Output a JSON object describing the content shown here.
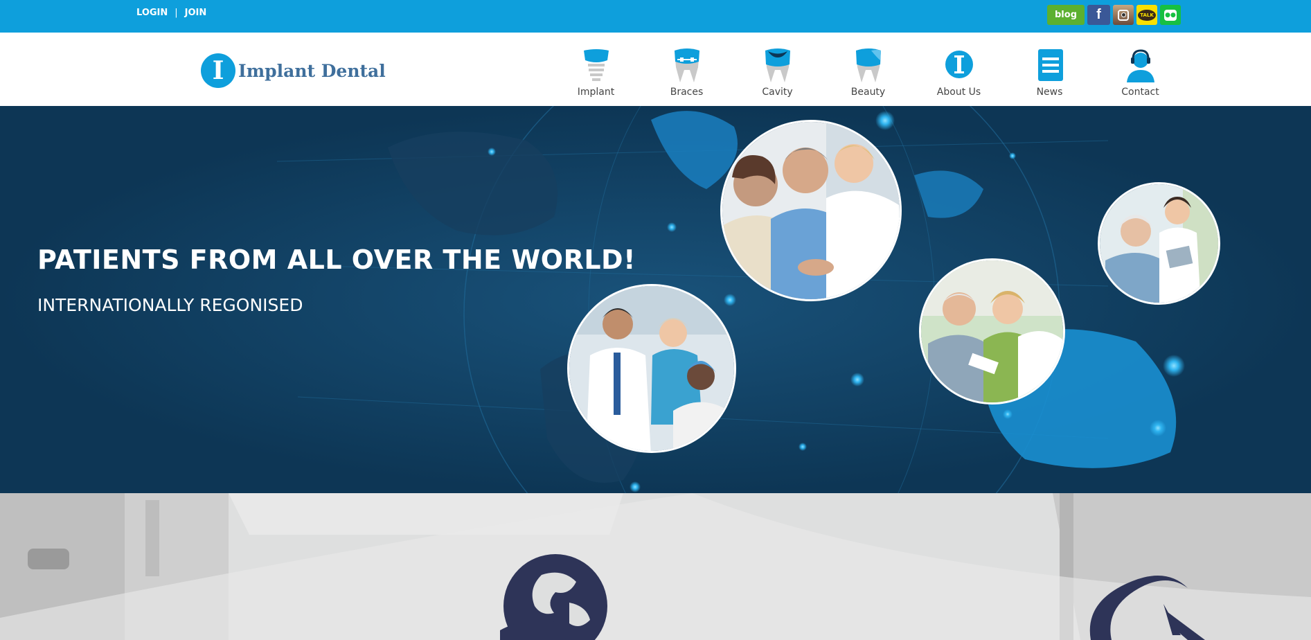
{
  "topbar": {
    "login_label": "LOGIN",
    "separator": "|",
    "join_label": "JOIN",
    "social": {
      "blog_label": "blog",
      "facebook_label": "f",
      "kakao_label": "TALK"
    }
  },
  "header": {
    "logo_letter": "I",
    "logo_text": "Implant Dental",
    "nav": [
      {
        "label": "Implant",
        "icon": "implant-tooth-icon"
      },
      {
        "label": "Braces",
        "icon": "braces-tooth-icon"
      },
      {
        "label": "Cavity",
        "icon": "cavity-tooth-icon"
      },
      {
        "label": "Beauty",
        "icon": "beauty-tooth-icon"
      },
      {
        "label": "About Us",
        "icon": "info-i-icon"
      },
      {
        "label": "News",
        "icon": "news-list-icon"
      },
      {
        "label": "Contact",
        "icon": "headset-person-icon"
      }
    ]
  },
  "hero": {
    "title": "PATIENTS FROM ALL OVER THE WORLD!",
    "subtitle": "INTERNATIONALLY REGONISED"
  },
  "colors": {
    "brand_blue": "#0e9fdc",
    "hero_bg": "#0d3655",
    "logo_text": "#3f6f9c",
    "icon_navy": "#2e3458"
  }
}
